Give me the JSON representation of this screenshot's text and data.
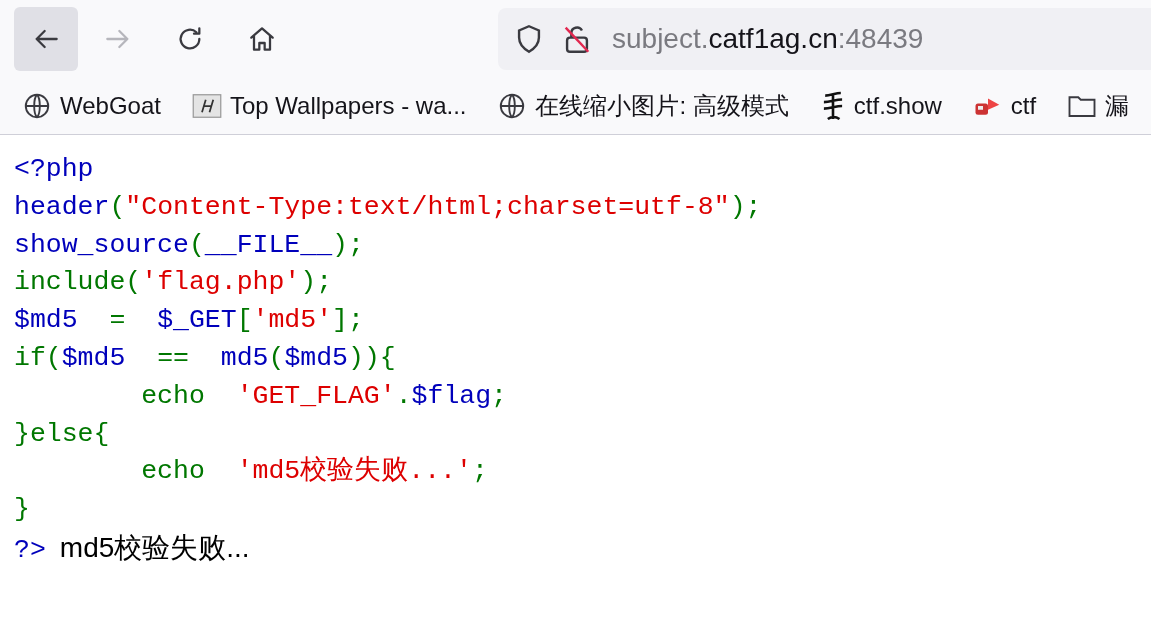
{
  "toolbar": {
    "buttons": [
      {
        "kind": "back",
        "disabled": false,
        "selected": true
      },
      {
        "kind": "forward",
        "disabled": true,
        "selected": false
      },
      {
        "kind": "reload",
        "disabled": false,
        "selected": false
      },
      {
        "kind": "home",
        "disabled": false,
        "selected": false
      }
    ],
    "url": {
      "prefix": "subject.",
      "host": "catf1ag.cn",
      "suffix": ":48439"
    }
  },
  "bookmarks": [
    {
      "kind": "globe",
      "label": "WebGoat"
    },
    {
      "kind": "script-h",
      "label": "Top Wallpapers - wa..."
    },
    {
      "kind": "globe",
      "label": "在线缩小图片: 高级模式"
    },
    {
      "kind": "brush",
      "label": "ctf.show"
    },
    {
      "kind": "red",
      "label": "ctf"
    },
    {
      "kind": "folder",
      "label": "漏"
    }
  ],
  "code": {
    "lines": [
      [
        {
          "kind": "default",
          "text": "<?php"
        }
      ],
      [
        {
          "kind": "default",
          "text": "header"
        },
        {
          "kind": "keyword",
          "text": "("
        },
        {
          "kind": "string",
          "text": "\"Content-Type:text/html;charset=utf-8\""
        },
        {
          "kind": "keyword",
          "text": ");"
        }
      ],
      [
        {
          "kind": "default",
          "text": "show_source"
        },
        {
          "kind": "keyword",
          "text": "("
        },
        {
          "kind": "default",
          "text": "__FILE__"
        },
        {
          "kind": "keyword",
          "text": ");"
        }
      ],
      [
        {
          "kind": "keyword",
          "text": "include("
        },
        {
          "kind": "string",
          "text": "'flag.php'"
        },
        {
          "kind": "keyword",
          "text": ");"
        }
      ],
      [
        {
          "kind": "default",
          "text": "$md5"
        },
        {
          "kind": "keyword",
          "text": "  =  "
        },
        {
          "kind": "default",
          "text": "$_GET"
        },
        {
          "kind": "keyword",
          "text": "["
        },
        {
          "kind": "string",
          "text": "'md5'"
        },
        {
          "kind": "keyword",
          "text": "];"
        }
      ],
      [
        {
          "kind": "keyword",
          "text": "if("
        },
        {
          "kind": "default",
          "text": "$md5"
        },
        {
          "kind": "keyword",
          "text": "  ==  "
        },
        {
          "kind": "default",
          "text": "md5"
        },
        {
          "kind": "keyword",
          "text": "("
        },
        {
          "kind": "default",
          "text": "$md5"
        },
        {
          "kind": "keyword",
          "text": ")){"
        }
      ],
      [
        {
          "kind": "keyword",
          "text": "        echo  "
        },
        {
          "kind": "string",
          "text": "'GET_FLAG'"
        },
        {
          "kind": "keyword",
          "text": "."
        },
        {
          "kind": "default",
          "text": "$flag"
        },
        {
          "kind": "keyword",
          "text": ";"
        }
      ],
      [
        {
          "kind": "keyword",
          "text": "}else{"
        }
      ],
      [
        {
          "kind": "keyword",
          "text": "        echo  "
        },
        {
          "kind": "string",
          "text": "'md5校验失败...'"
        },
        {
          "kind": "keyword",
          "text": ";"
        }
      ],
      [
        {
          "kind": "keyword",
          "text": "}"
        }
      ],
      [
        {
          "kind": "default",
          "text": "?>"
        }
      ]
    ]
  },
  "output": "md5校验失败..."
}
